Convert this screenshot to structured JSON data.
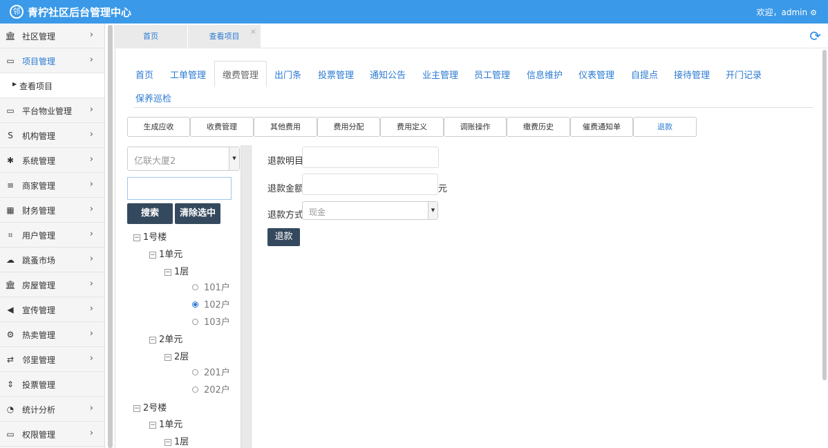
{
  "header": {
    "title": "青柠社区后台管理中心",
    "welcome": "欢迎，admin",
    "logo_char": "邻"
  },
  "sidebar": {
    "items": [
      {
        "label": "社区管理",
        "icon": "bank-icon",
        "glyph": "🏛"
      },
      {
        "label": "项目管理",
        "icon": "discover-card-icon",
        "glyph": "▭"
      },
      {
        "label": "查看项目",
        "sub": true
      },
      {
        "label": "平台物业管理",
        "icon": "monitor-icon",
        "glyph": "▭"
      },
      {
        "label": "机构管理",
        "icon": "stripe-icon",
        "glyph": "S"
      },
      {
        "label": "系统管理",
        "icon": "yelp-icon",
        "glyph": "✱"
      },
      {
        "label": "商家管理",
        "icon": "bars-icon",
        "glyph": "≡"
      },
      {
        "label": "财务管理",
        "icon": "calculator-icon",
        "glyph": "▦"
      },
      {
        "label": "用户管理",
        "icon": "crop-icon",
        "glyph": "⌗"
      },
      {
        "label": "跳蚤市场",
        "icon": "cloud-icon",
        "glyph": "☁"
      },
      {
        "label": "房屋管理",
        "icon": "bank-icon",
        "glyph": "🏛"
      },
      {
        "label": "宣传管理",
        "icon": "volume-icon",
        "glyph": "◀"
      },
      {
        "label": "热卖管理",
        "icon": "gear-icon",
        "glyph": "⚙"
      },
      {
        "label": "邻里管理",
        "icon": "retweet-icon",
        "glyph": "⇄"
      },
      {
        "label": "投票管理",
        "icon": "sort-icon",
        "glyph": "⇕"
      },
      {
        "label": "统计分析",
        "icon": "pie-chart-icon",
        "glyph": "◔"
      },
      {
        "label": "权限管理",
        "icon": "desktop-icon",
        "glyph": "▭"
      }
    ]
  },
  "tabs": {
    "home": "首页",
    "current": "查看项目"
  },
  "nav": [
    "首页",
    "工单管理",
    "缴费管理",
    "出门条",
    "投票管理",
    "通知公告",
    "业主管理",
    "员工管理",
    "信息维护",
    "仪表管理",
    "自提点",
    "接待管理",
    "开门记录",
    "保养巡检"
  ],
  "subtabs": [
    "生成应收",
    "收费管理",
    "其他费用",
    "费用分配",
    "费用定义",
    "调账操作",
    "缴费历史",
    "催费通知单",
    "退款"
  ],
  "tree_panel": {
    "building_select": "亿联大厦2",
    "search_value": "",
    "search_button": "搜索",
    "clear_button": "清除选中",
    "tree": {
      "b1": "1号楼",
      "b1u1": "1单元",
      "b1u1f1": "1层",
      "r101": "101户",
      "r102": "102户",
      "r103": "103户",
      "b1u2": "2单元",
      "b1u2f2": "2层",
      "r201": "201户",
      "r202": "202户",
      "b2": "2号楼",
      "b2u1": "1单元",
      "b2u1f1": "1层",
      "selected": "102户"
    }
  },
  "refund_form": {
    "item_label": "退款明目",
    "item_value": "",
    "amount_label": "退款金额",
    "amount_value": "",
    "unit": "元",
    "method_label": "退款方式",
    "method_value": "现金",
    "submit": "退款"
  },
  "colors": {
    "header": "#3a99e8",
    "link": "#2a7ad2",
    "dark_button": "#34495e"
  }
}
